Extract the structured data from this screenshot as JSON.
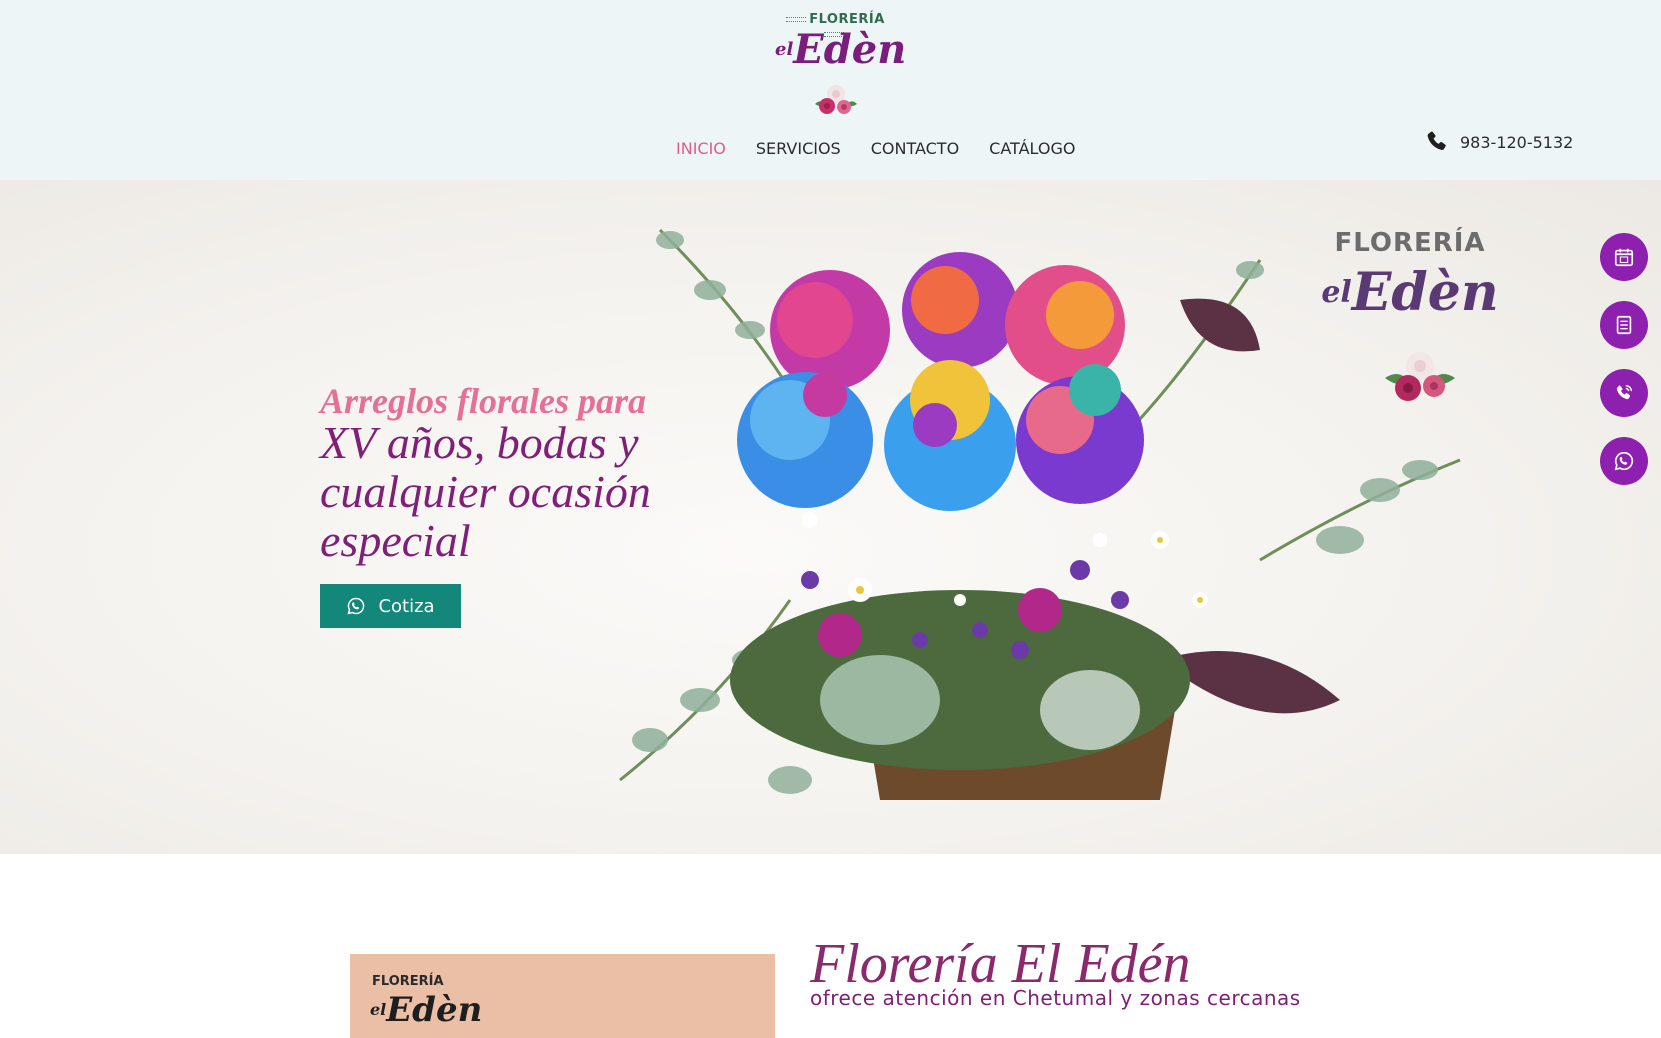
{
  "brand": {
    "logo_top": "FLORERÍA",
    "logo_el": "el",
    "logo_name": "Edèn"
  },
  "nav": {
    "items": [
      {
        "label": "INICIO",
        "active": true
      },
      {
        "label": "SERVICIOS",
        "active": false
      },
      {
        "label": "CONTACTO",
        "active": false
      },
      {
        "label": "CATÁLOGO",
        "active": false
      }
    ]
  },
  "header": {
    "phone": "983-120-5132"
  },
  "hero": {
    "subtitle": "Arreglos florales para",
    "title": "XV años, bodas y cualquier ocasión especial",
    "cta_label": "Cotiza",
    "watermark_top": "FLORERÍA",
    "watermark_el": "el",
    "watermark_name": "Edèn"
  },
  "floating": {
    "icons": [
      "calendar-icon",
      "document-icon",
      "phone-call-icon",
      "whatsapp-icon"
    ]
  },
  "about": {
    "title": "Florería El Edén",
    "subtitle": "ofrece atención en Chetumal y zonas cercanas",
    "card_logo_top": "FLORERÍA",
    "card_logo_el": "el",
    "card_logo_name": "Edèn"
  },
  "colors": {
    "header_bg": "#edf5f6",
    "accent_pink": "#e05d89",
    "brand_purple": "#801f78",
    "cta_green": "#12877a",
    "float_purple": "#8e20b0",
    "card_peach": "#ebbfa5"
  }
}
